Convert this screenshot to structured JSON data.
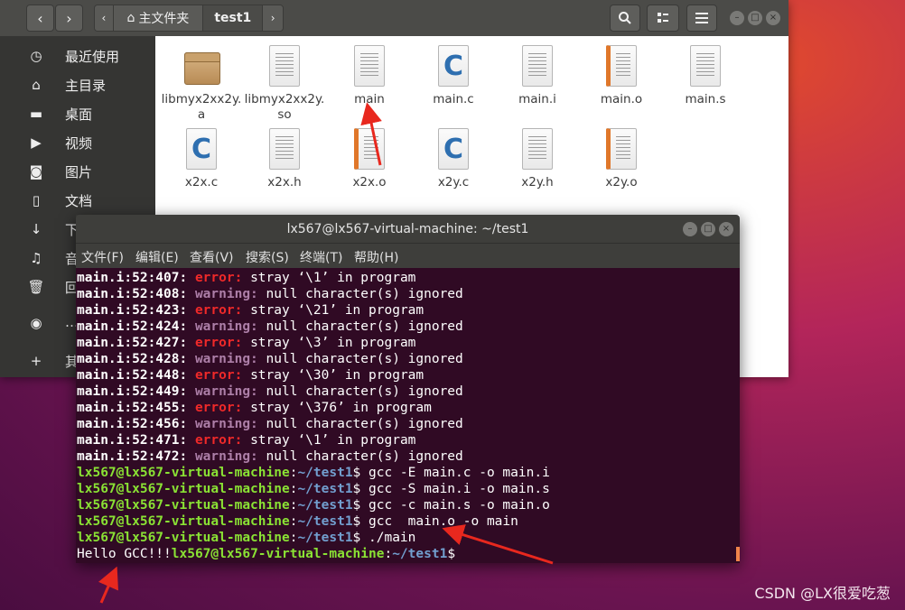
{
  "file_manager": {
    "path": {
      "home_label": "主文件夹",
      "current": "test1"
    },
    "sidebar": [
      {
        "icon": "clock-icon",
        "label": "最近使用"
      },
      {
        "icon": "home-icon",
        "label": "主目录"
      },
      {
        "icon": "folder-icon",
        "label": "桌面"
      },
      {
        "icon": "video-icon",
        "label": "视频"
      },
      {
        "icon": "camera-icon",
        "label": "图片"
      },
      {
        "icon": "document-icon",
        "label": "文档"
      },
      {
        "icon": "download-icon",
        "label": "下"
      },
      {
        "icon": "music-icon",
        "label": "音"
      },
      {
        "icon": "trash-icon",
        "label": "回"
      },
      {
        "icon": "disc-icon",
        "label": "…"
      },
      {
        "icon": "plus-icon",
        "label": "其"
      }
    ],
    "files": [
      {
        "name": "libmyx2xx2y.a",
        "type": "archive"
      },
      {
        "name": "libmyx2xx2y.so",
        "type": "doc"
      },
      {
        "name": "main",
        "type": "doc"
      },
      {
        "name": "main.c",
        "type": "c"
      },
      {
        "name": "main.i",
        "type": "doc"
      },
      {
        "name": "main.o",
        "type": "obj"
      },
      {
        "name": "main.s",
        "type": "doc"
      },
      {
        "name": "x2x.c",
        "type": "c"
      },
      {
        "name": "x2x.h",
        "type": "doc"
      },
      {
        "name": "x2x.o",
        "type": "obj"
      },
      {
        "name": "x2y.c",
        "type": "c"
      },
      {
        "name": "x2y.h",
        "type": "doc"
      },
      {
        "name": "x2y.o",
        "type": "obj"
      }
    ]
  },
  "terminal": {
    "title": "lx567@lx567-virtual-machine: ~/test1",
    "menu": [
      "文件(F)",
      "编辑(E)",
      "查看(V)",
      "搜索(S)",
      "终端(T)",
      "帮助(H)"
    ],
    "diagnostics": [
      {
        "loc": "main.i:52:407:",
        "kind": "error:",
        "msg": " stray ‘\\1’ in program"
      },
      {
        "loc": "main.i:52:408:",
        "kind": "warning:",
        "msg": " null character(s) ignored"
      },
      {
        "loc": "main.i:52:423:",
        "kind": "error:",
        "msg": " stray ‘\\21’ in program"
      },
      {
        "loc": "main.i:52:424:",
        "kind": "warning:",
        "msg": " null character(s) ignored"
      },
      {
        "loc": "main.i:52:427:",
        "kind": "error:",
        "msg": " stray ‘\\3’ in program"
      },
      {
        "loc": "main.i:52:428:",
        "kind": "warning:",
        "msg": " null character(s) ignored"
      },
      {
        "loc": "main.i:52:448:",
        "kind": "error:",
        "msg": " stray ‘\\30’ in program"
      },
      {
        "loc": "main.i:52:449:",
        "kind": "warning:",
        "msg": " null character(s) ignored"
      },
      {
        "loc": "main.i:52:455:",
        "kind": "error:",
        "msg": " stray ‘\\376’ in program"
      },
      {
        "loc": "main.i:52:456:",
        "kind": "warning:",
        "msg": " null character(s) ignored"
      },
      {
        "loc": "main.i:52:471:",
        "kind": "error:",
        "msg": " stray ‘\\1’ in program"
      },
      {
        "loc": "main.i:52:472:",
        "kind": "warning:",
        "msg": " null character(s) ignored"
      }
    ],
    "prompt_user": "lx567@lx567-virtual-machine",
    "prompt_colon": ":",
    "prompt_path": "~/test1",
    "prompt_dollar": "$",
    "commands": [
      " gcc -E main.c -o main.i",
      " gcc -S main.i -o main.s",
      " gcc -c main.s -o main.o",
      " gcc  main.o -o main",
      " ./main"
    ],
    "program_output": "Hello GCC!!!"
  },
  "watermark": "CSDN @LX很爱吃葱"
}
